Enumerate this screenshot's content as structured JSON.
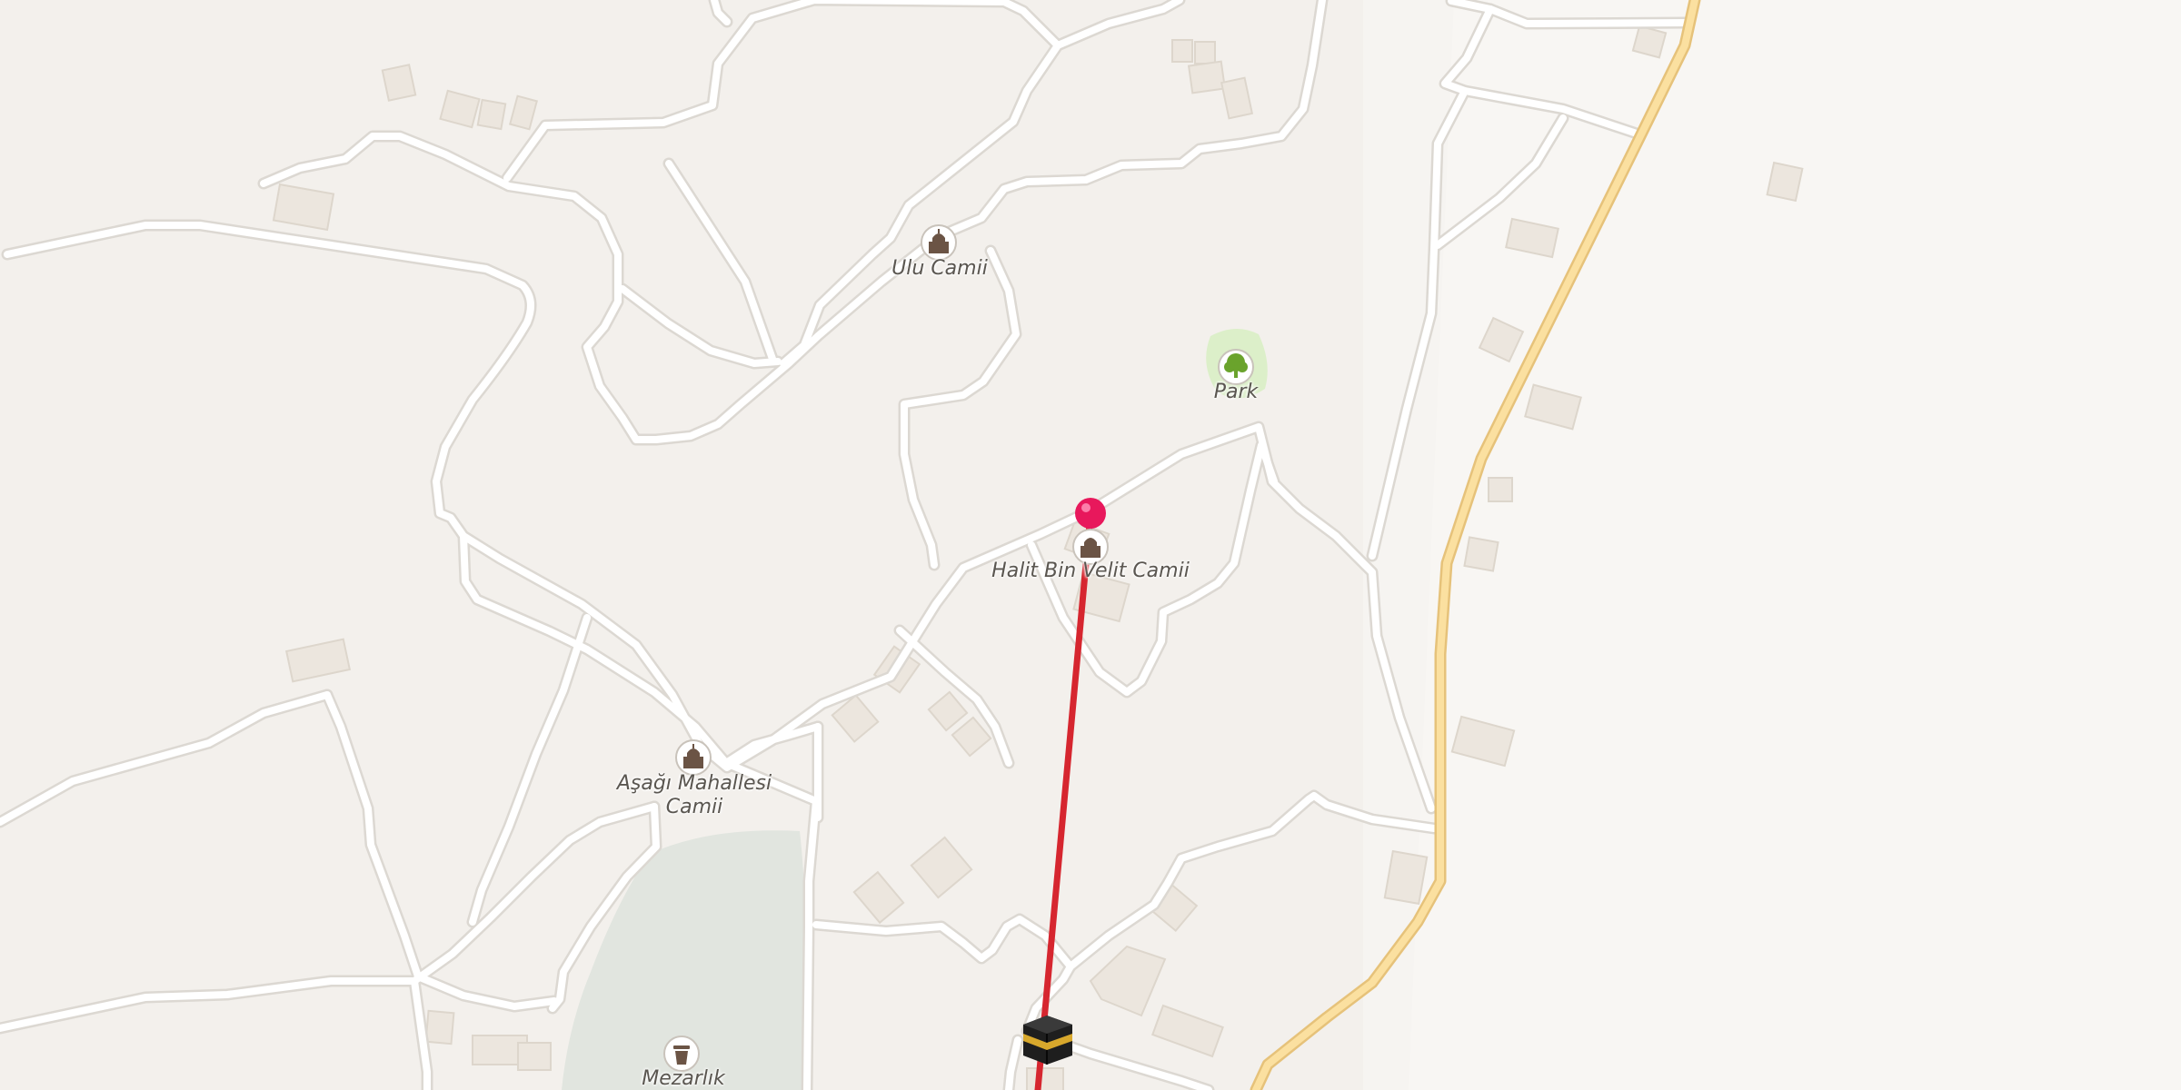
{
  "map": {
    "poi_labels": {
      "ulu_camii": "Ulu Camii",
      "park": "Park",
      "halit_camii": "Halit Bin Velit Camii",
      "asagi_camii": "Aşağı Mahallesi Camii",
      "mezarlik": "Mezarlık"
    },
    "icons": {
      "mosque": "mosque-icon",
      "tree": "tree-icon",
      "cemetery": "cemetery-icon",
      "kaaba": "kaaba-icon",
      "pin": "location-pin-icon"
    },
    "colors": {
      "background": "#f6f4f1",
      "road": "#ffffff",
      "road_casing": "#dcd8d2",
      "main_road": "#f7d98f",
      "qibla_line": "#d6262f",
      "pin": "#e8185c",
      "park": "#dcefc9",
      "cemetery": "#e1e5df",
      "building": "#ece6de"
    }
  }
}
